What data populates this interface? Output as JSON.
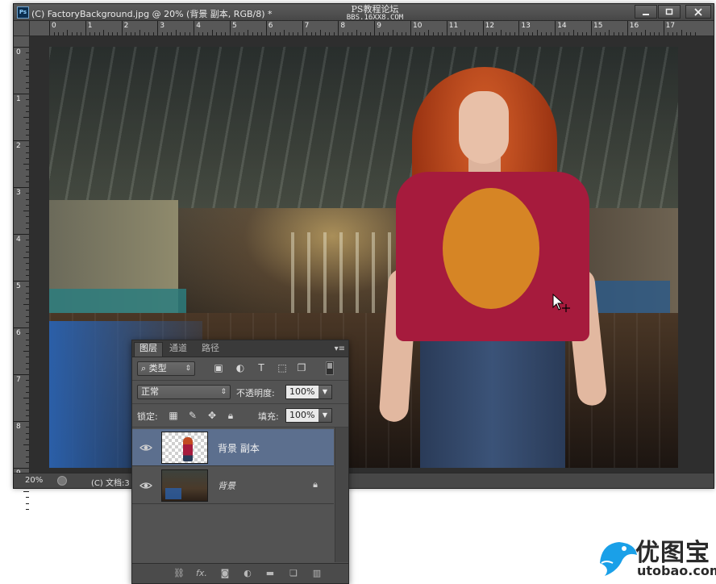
{
  "window": {
    "title": "(C) FactoryBackground.jpg @ 20% (背景 副本, RGB/8) *",
    "app_logo": "Ps",
    "watermark_line1": "PS教程论坛",
    "watermark_line2": "BBS.16XX8.COM"
  },
  "rulers": {
    "top": [
      "0",
      "1",
      "2",
      "3",
      "4",
      "5",
      "6",
      "7",
      "8",
      "9",
      "10",
      "11",
      "12",
      "13",
      "14",
      "15",
      "16",
      "17"
    ],
    "left": [
      "0",
      "1",
      "2",
      "3",
      "4",
      "5",
      "6",
      "7",
      "8",
      "9"
    ]
  },
  "statusbar": {
    "zoom": "20%",
    "doc_info": "(C) 文档:3"
  },
  "layers_panel": {
    "tabs": [
      {
        "label": "图层",
        "active": true
      },
      {
        "label": "通道",
        "active": false
      },
      {
        "label": "路径",
        "active": false
      }
    ],
    "menu_glyph": "▾≡",
    "filter_kind": "类型",
    "filter_glyph": "⌕",
    "blend_mode": "正常",
    "opacity_label": "不透明度:",
    "opacity_value": "100%",
    "lock_label": "锁定:",
    "fill_label": "填充:",
    "fill_value": "100%",
    "layers": [
      {
        "name": "背景 副本",
        "selected": true,
        "locked": false,
        "visible": true
      },
      {
        "name": "背景",
        "selected": false,
        "locked": true,
        "visible": true
      }
    ],
    "bottom_icons": [
      "link-icon",
      "fx-icon",
      "mask-icon",
      "adjustment-icon",
      "folder-icon",
      "new-layer-icon",
      "trash-icon"
    ],
    "bottom_fx_text": "fx."
  },
  "branding": {
    "site_name": "优图宝",
    "site_url": "utobao.com"
  },
  "colors": {
    "selected_layer": "#5c6f8e",
    "panel_bg": "#535353",
    "brand_blue": "#1aa0e8"
  }
}
